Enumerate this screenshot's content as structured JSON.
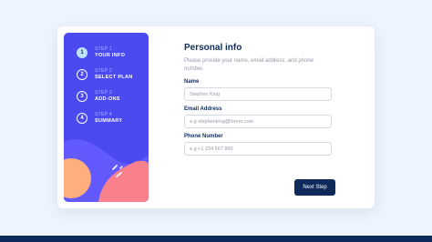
{
  "steps": [
    {
      "num": "1",
      "sub": "STEP 1",
      "label": "YOUR INFO",
      "active": true
    },
    {
      "num": "2",
      "sub": "STEP 2",
      "label": "SELECT PLAN",
      "active": false
    },
    {
      "num": "3",
      "sub": "STEP 3",
      "label": "ADD-ONS",
      "active": false
    },
    {
      "num": "4",
      "sub": "STEP 4",
      "label": "SUMMARY",
      "active": false
    }
  ],
  "form": {
    "title": "Personal info",
    "description": "Please provide your name, email address, and phone number.",
    "fields": {
      "name": {
        "label": "Name",
        "value": "Stephen King"
      },
      "email": {
        "label": "Email Address",
        "placeholder": "e.g stephenking@lorem.com"
      },
      "phone": {
        "label": "Phone Number",
        "placeholder": "e.g +1 234 567 890"
      }
    },
    "next_label": "Next Step"
  },
  "colors": {
    "background": "#eef4fe",
    "sidebar": "#4a4af0",
    "active_step": "#bde3fa",
    "primary_dark": "#0e2a5a",
    "accent_orange": "#ffaf7e",
    "accent_pink": "#f9818e"
  }
}
